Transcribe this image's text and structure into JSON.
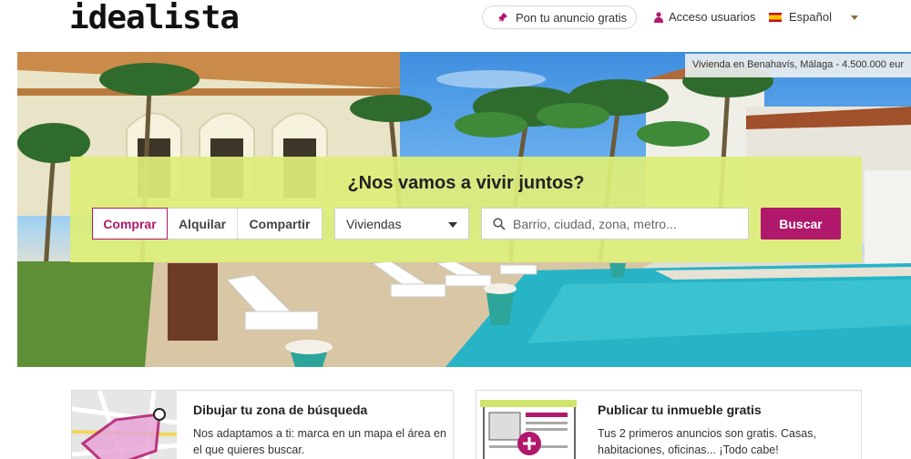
{
  "header": {
    "logo": "idealista",
    "publish_label": "Pon tu anuncio gratis",
    "login_label": "Acceso usuarios",
    "language_label": "Español"
  },
  "hero": {
    "caption": "Vivienda en Benahavís, Málaga - 4.500.000 eur"
  },
  "search": {
    "title": "¿Nos vamos a vivir juntos?",
    "tabs": [
      {
        "label": "Comprar",
        "active": true
      },
      {
        "label": "Alquilar",
        "active": false
      },
      {
        "label": "Compartir",
        "active": false
      }
    ],
    "property_type": "Viviendas",
    "placeholder": "Barrio, ciudad, zona, metro...",
    "button_label": "Buscar"
  },
  "cards": [
    {
      "title": "Dibujar tu zona de búsqueda",
      "text": "Nos adaptamos a ti: marca en un mapa el área en el que quieres buscar.",
      "icon": "map-draw-icon"
    },
    {
      "title": "Publicar tu inmueble gratis",
      "text": "Tus 2 primeros anuncios son gratis. Casas, habitaciones, oficinas... ¡Todo cabe!",
      "icon": "publish-listing-icon"
    }
  ],
  "colors": {
    "brand": "#b0186b",
    "panel": "#deee78"
  }
}
